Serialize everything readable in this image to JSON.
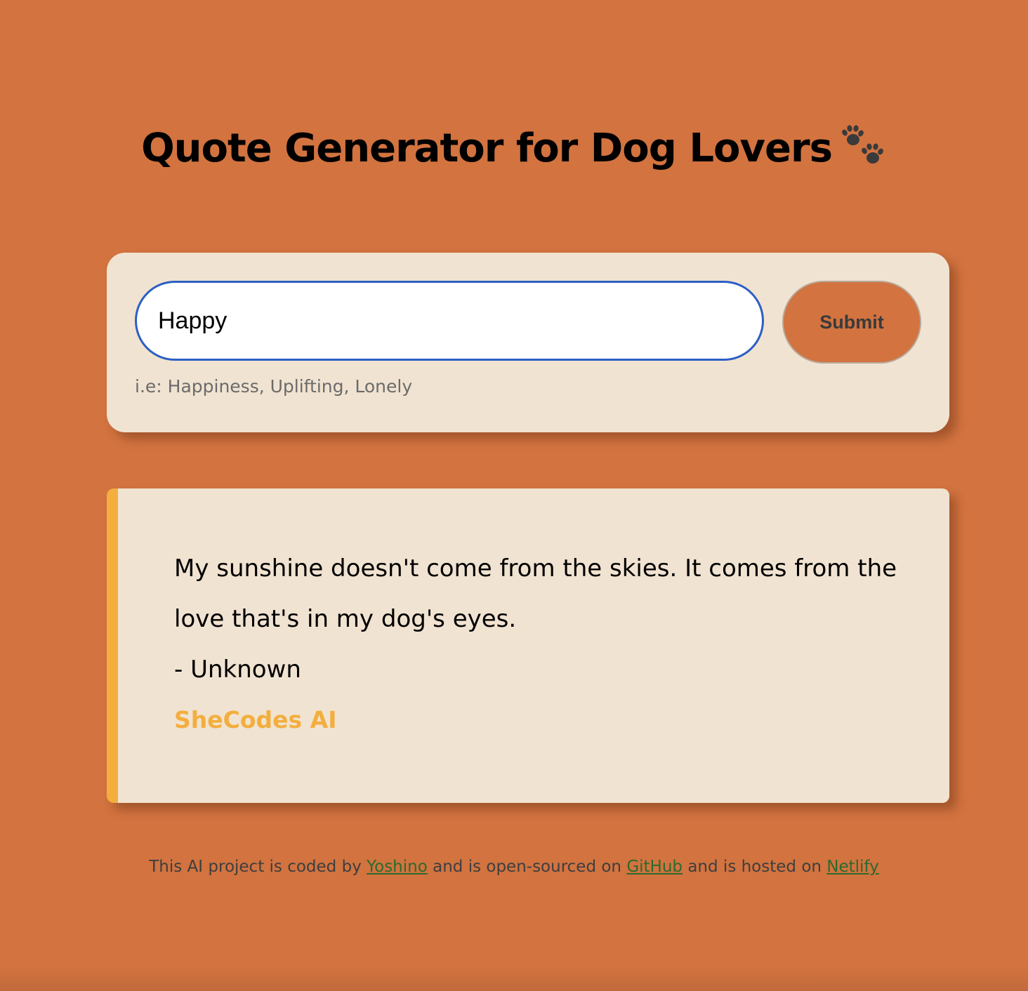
{
  "header": {
    "title": "Quote Generator for Dog Lovers",
    "title_icon": "paw-prints-icon"
  },
  "search": {
    "value": "Happy",
    "submit_label": "Submit",
    "hint": "i.e: Happiness, Uplifting, Lonely"
  },
  "quote": {
    "text": "My sunshine doesn't come from the skies. It comes from the love that's in my dog's eyes.",
    "author": "- Unknown",
    "brand": "SheCodes AI"
  },
  "footer": {
    "prefix": "This AI project is coded by ",
    "author_link": "Yoshino",
    "middle": " and is open-sourced on ",
    "github_link": "GitHub",
    "middle2": " and is hosted on ",
    "netlify_link": "Netlify"
  },
  "colors": {
    "background": "#d27340",
    "card": "#f1e3d1",
    "accent": "#f3ae3e",
    "input_border": "#2c5fc4",
    "link": "#2c6a2c"
  }
}
